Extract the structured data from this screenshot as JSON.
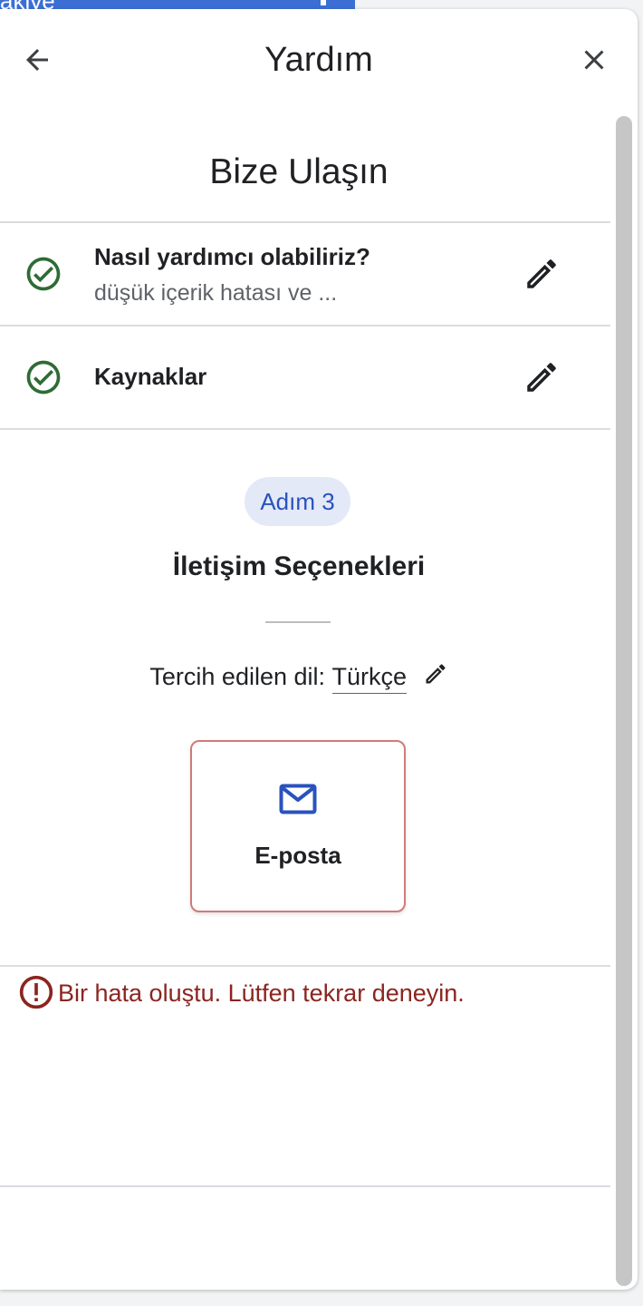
{
  "background": {
    "fragment_text": "akiye"
  },
  "header": {
    "title": "Yardım",
    "back_icon": "arrow-back-icon",
    "close_icon": "close-icon"
  },
  "page": {
    "title": "Bize Ulaşın"
  },
  "steps": [
    {
      "title": "Nasıl yardımcı olabiliriz?",
      "subtitle": "düşük içerik hatası ve ...",
      "status_icon": "check-circle-icon",
      "edit_icon": "pencil-icon"
    },
    {
      "title": "Kaynaklar",
      "subtitle": "",
      "status_icon": "check-circle-icon",
      "edit_icon": "pencil-icon"
    }
  ],
  "current_step": {
    "chip": "Adım 3",
    "title": "İletişim Seçenekleri",
    "language_label": "Tercih edilen dil:",
    "language_value": "Türkçe"
  },
  "contact_options": [
    {
      "label": "E-posta",
      "icon": "mail-icon"
    }
  ],
  "error": {
    "message": "Bir hata oluştu. Lütfen tekrar deneyin.",
    "icon": "error-icon"
  },
  "colors": {
    "accent_blue": "#2a52be",
    "chip_bg": "#e3e9f7",
    "check_green": "#2e6b35",
    "error_red": "#8b2520",
    "card_border": "#d27a7a"
  }
}
